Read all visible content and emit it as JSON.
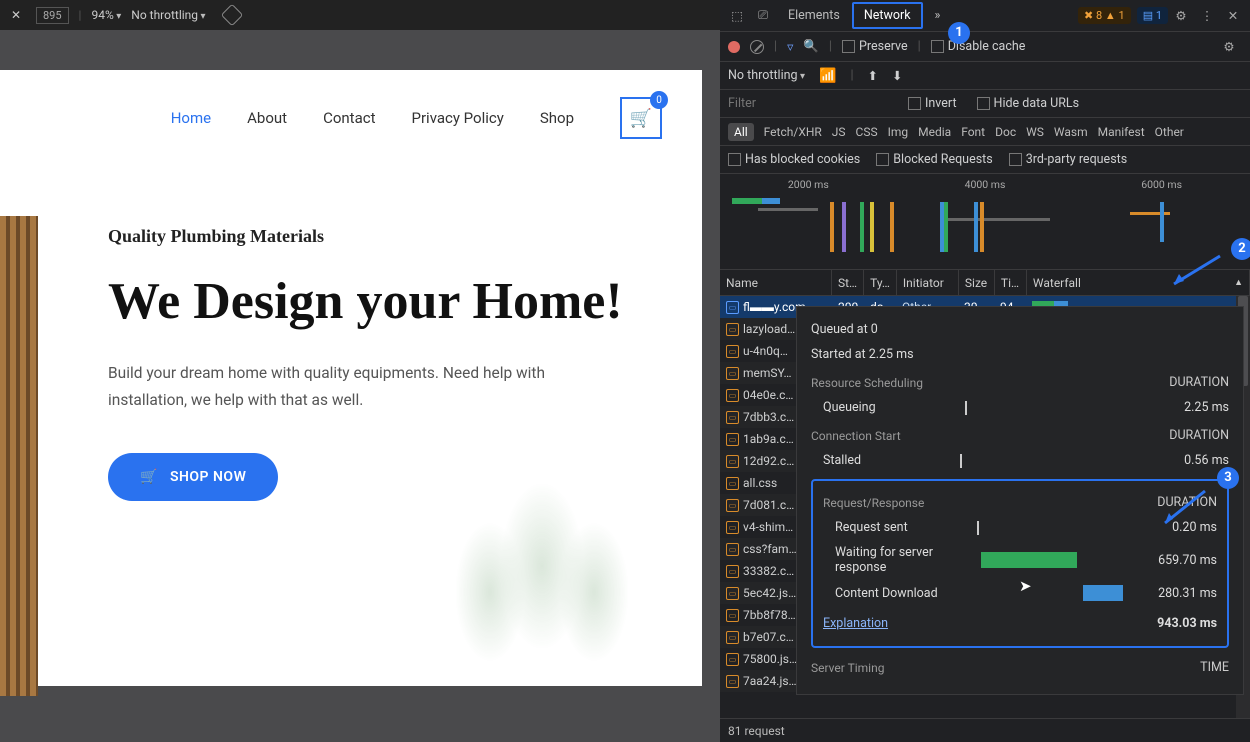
{
  "left": {
    "width_box": "895",
    "zoom": "94%",
    "throttle": "No throttling"
  },
  "site": {
    "nav": [
      "Home",
      "About",
      "Contact",
      "Privacy Policy",
      "Shop"
    ],
    "cart_count": "0",
    "subhead": "Quality Plumbing Materials",
    "headline": "We Design your Home!",
    "paragraph": "Build your dream home with quality equipments. Need help with installation, we help with that as well.",
    "cta": "SHOP NOW"
  },
  "devtools": {
    "tabs": {
      "elements": "Elements",
      "network": "Network",
      "more": "»"
    },
    "warn_count": "8",
    "warn_tri": "1",
    "msg_count": "1",
    "row2": {
      "preserve": "Preserve",
      "disable_cache": "Disable cache"
    },
    "row3": {
      "throttle": "No throttling"
    },
    "filter_placeholder": "Filter",
    "filter_opts": {
      "invert": "Invert",
      "hide": "Hide data URLs"
    },
    "types": [
      "All",
      "Fetch/XHR",
      "JS",
      "CSS",
      "Img",
      "Media",
      "Font",
      "Doc",
      "WS",
      "Wasm",
      "Manifest",
      "Other"
    ],
    "opts": [
      "Has blocked cookies",
      "Blocked Requests",
      "3rd-party requests"
    ],
    "ov_ticks": [
      "2000 ms",
      "4000 ms",
      "6000 ms"
    ],
    "cols": {
      "name": "Name",
      "st": "St…",
      "ty": "Ty…",
      "in": "Initiator",
      "sz": "Size",
      "ti": "Ti…",
      "wf": "Waterfall"
    },
    "rows": [
      {
        "ico": "doc",
        "name": "fl▬▬y.com…",
        "st": "200",
        "ty": "do…",
        "in": "Other",
        "sz": "30…",
        "ti": "94…",
        "sel": true
      },
      {
        "ico": "css",
        "name": "lazyload…"
      },
      {
        "ico": "css",
        "name": "u-4n0q…"
      },
      {
        "ico": "css",
        "name": "memSY…"
      },
      {
        "ico": "css",
        "name": "04e0e.c…"
      },
      {
        "ico": "css",
        "name": "7dbb3.c…"
      },
      {
        "ico": "css",
        "name": "1ab9a.c…"
      },
      {
        "ico": "css",
        "name": "12d92.c…"
      },
      {
        "ico": "css",
        "name": "all.css"
      },
      {
        "ico": "css",
        "name": "7d081.c…"
      },
      {
        "ico": "js",
        "name": "v4-shim…"
      },
      {
        "ico": "css",
        "name": "css?fam…"
      },
      {
        "ico": "css",
        "name": "33382.c…"
      },
      {
        "ico": "js",
        "name": "5ec42.js…"
      },
      {
        "ico": "js",
        "name": "7bb8f78…"
      },
      {
        "ico": "css",
        "name": "b7e07.c…"
      },
      {
        "ico": "js",
        "name": "75800.js…"
      },
      {
        "ico": "js",
        "name": "7aa24.js…"
      }
    ],
    "timing": {
      "queued": "Queued at 0",
      "started": "Started at 2.25 ms",
      "sched_h": "Resource Scheduling",
      "dur_h": "DURATION",
      "queueing": "Queueing",
      "queueing_v": "2.25 ms",
      "conn_h": "Connection Start",
      "stalled": "Stalled",
      "stalled_v": "0.56 ms",
      "rr_h": "Request/Response",
      "sent": "Request sent",
      "sent_v": "0.20 ms",
      "ttfb": "Waiting for server response",
      "ttfb_v": "659.70 ms",
      "dl": "Content Download",
      "dl_v": "280.31 ms",
      "explain": "Explanation",
      "total": "943.03 ms",
      "st_h": "Server Timing",
      "time_h": "TIME"
    },
    "footer": "81 request",
    "callouts": {
      "c1": "1",
      "c2": "2",
      "c3": "3"
    }
  }
}
